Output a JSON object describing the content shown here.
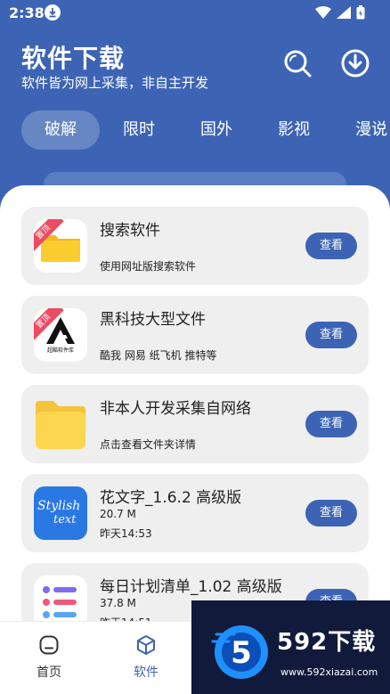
{
  "status_bar": {
    "time": "2:38"
  },
  "header": {
    "title": "软件下载",
    "subtitle": "软件皆为网上采集，非自主开发",
    "background_color": "#3d64b4"
  },
  "tabs": [
    {
      "label": "破解",
      "active": true
    },
    {
      "label": "限时",
      "active": false
    },
    {
      "label": "国外",
      "active": false
    },
    {
      "label": "影视",
      "active": false
    },
    {
      "label": "漫说",
      "active": false
    }
  ],
  "items": [
    {
      "title": "搜索软件",
      "lines": [
        "使用网址版搜索软件"
      ],
      "button": "查看",
      "badge": "置顶",
      "icon": "folder-icon"
    },
    {
      "title": "黑科技大型文件",
      "lines": [
        "酷我 网易 纸飞机 推特等"
      ],
      "button": "查看",
      "badge": "置顶",
      "icon": "black-tech-logo-icon",
      "icon_text": "超酷软件库"
    },
    {
      "title": "非本人开发采集自网络",
      "lines": [
        "点击查看文件夹详情"
      ],
      "button": "查看",
      "icon": "yellow-folder-icon"
    },
    {
      "title": "花文字_1.6.2 高级版",
      "lines": [
        "20.7 M",
        "昨天14:53"
      ],
      "button": "查看",
      "icon": "stylish-text-icon",
      "icon_text": [
        "Stylish",
        "text"
      ]
    },
    {
      "title": "每日计划清单_1.02 高级版",
      "lines": [
        "37.8 M",
        "昨天14:51"
      ],
      "button": "查看",
      "icon": "checklist-icon"
    }
  ],
  "bottom_nav": [
    {
      "label": "首页",
      "icon": "home-icon",
      "active": false
    },
    {
      "label": "软件",
      "icon": "cube-icon",
      "active": true
    }
  ],
  "watermark": {
    "brand": "592下载",
    "url": "www.592xiazai.com",
    "logo_text": "5"
  }
}
